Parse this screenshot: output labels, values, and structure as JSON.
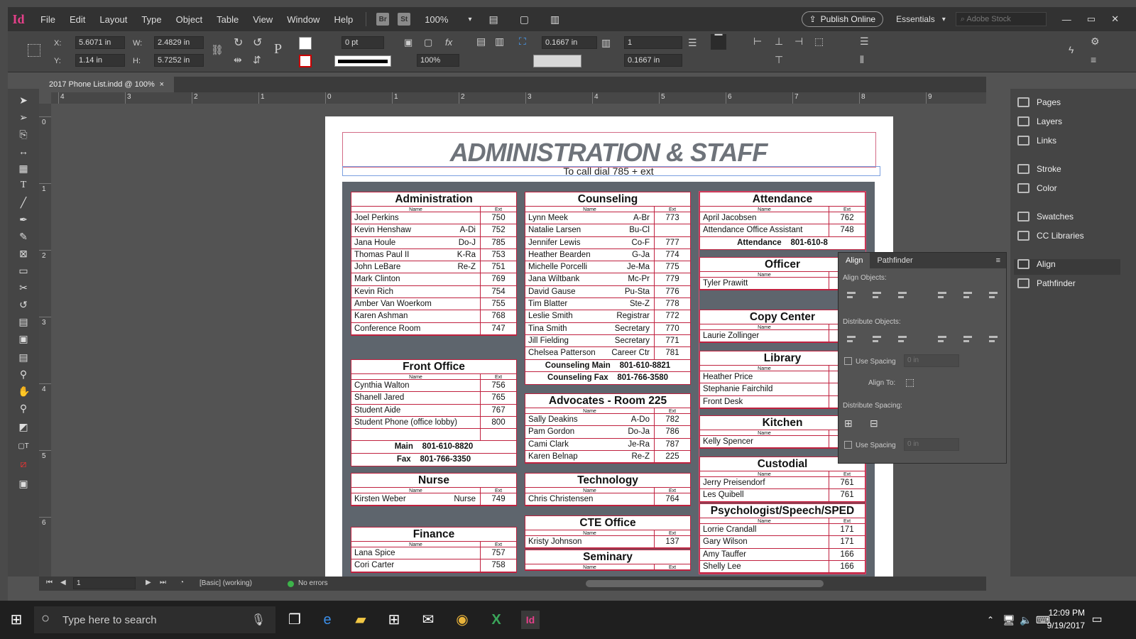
{
  "app": {
    "logo": "Id"
  },
  "menu": [
    "File",
    "Edit",
    "Layout",
    "Type",
    "Object",
    "Table",
    "View",
    "Window",
    "Help"
  ],
  "menubar": {
    "br": "Br",
    "st": "St",
    "zoom": "100%",
    "publish": "Publish Online",
    "workspace": "Essentials",
    "stock_placeholder": "Adobe Stock"
  },
  "control": {
    "x_label": "X:",
    "x": "5.6071 in",
    "y_label": "Y:",
    "y": "1.14 in",
    "w_label": "W:",
    "w": "2.4829 in",
    "h_label": "H:",
    "h": "5.7252 in",
    "stroke": "0 pt",
    "scale": "100%",
    "gap1": "0.1667 in",
    "gap2": "0.1667 in",
    "cols": "1"
  },
  "tab": {
    "label": "2017 Phone List.indd @ 100%",
    "close": "×"
  },
  "ruler_h": [
    "4",
    "3",
    "2",
    "1",
    "0",
    "1",
    "2",
    "3",
    "4",
    "5",
    "6",
    "7",
    "8",
    "9"
  ],
  "ruler_v": [
    "0",
    "1",
    "2",
    "3",
    "4",
    "5",
    "6"
  ],
  "doc": {
    "title": "ADMINISTRATION & STAFF",
    "subtitle": "To call dial 785 + ext",
    "col_name": "Name",
    "col_ext": "Ext"
  },
  "blocks": {
    "admin": {
      "title": "Administration",
      "rows": [
        [
          "Joel Perkins",
          "",
          "750"
        ],
        [
          "Kevin Henshaw",
          "A-Di",
          "752"
        ],
        [
          "Jana Houle",
          "Do-J",
          "785"
        ],
        [
          "Thomas Paul II",
          "K-Ra",
          "753"
        ],
        [
          "John LeBare",
          "Re-Z",
          "751"
        ],
        [
          "Mark Clinton",
          "",
          "769"
        ],
        [
          "Kevin Rich",
          "",
          "754"
        ],
        [
          "Amber Van Woerkom",
          "",
          "755"
        ],
        [
          "Karen Ashman",
          "",
          "768"
        ],
        [
          "Conference Room",
          "",
          "747"
        ]
      ]
    },
    "front": {
      "title": "Front Office",
      "rows": [
        [
          "Cynthia Walton",
          "",
          "756"
        ],
        [
          "Shanell Jared",
          "",
          "765"
        ],
        [
          "Student Aide",
          "",
          "767"
        ],
        [
          "Student Phone (office lobby)",
          "",
          "800"
        ],
        [
          "",
          "",
          ""
        ]
      ],
      "foot": [
        "Main    801-610-8820",
        "Fax    801-766-3350"
      ]
    },
    "nurse": {
      "title": "Nurse",
      "rows": [
        [
          "Kirsten Weber",
          "Nurse",
          "749"
        ]
      ]
    },
    "finance": {
      "title": "Finance",
      "rows": [
        [
          "Lana Spice",
          "",
          "757"
        ],
        [
          "Cori Carter",
          "",
          "758"
        ]
      ]
    },
    "counseling": {
      "title": "Counseling",
      "rows": [
        [
          "Lynn Meek",
          "A-Br",
          "773"
        ],
        [
          "Natalie Larsen",
          "Bu-Cl",
          ""
        ],
        [
          "Jennifer Lewis",
          "Co-F",
          "777"
        ],
        [
          "Heather Bearden",
          "G-Ja",
          "774"
        ],
        [
          "Michelle Porcelli",
          "Je-Ma",
          "775"
        ],
        [
          "Jana Wiltbank",
          "Mc-Pr",
          "779"
        ],
        [
          "David Gause",
          "Pu-Sta",
          "776"
        ],
        [
          "Tim Blatter",
          "Ste-Z",
          "778"
        ],
        [
          "Leslie Smith",
          "Registrar",
          "772"
        ],
        [
          "Tina Smith",
          "Secretary",
          "770"
        ],
        [
          "Jill Fielding",
          "Secretary",
          "771"
        ],
        [
          "Chelsea Patterson",
          "Career Ctr",
          "781"
        ]
      ],
      "foot": [
        "Counseling Main    801-610-8821",
        "Counseling Fax    801-766-3580"
      ]
    },
    "advocates": {
      "title": "Advocates - Room 225",
      "rows": [
        [
          "Sally Deakins",
          "A-Do",
          "782"
        ],
        [
          "Pam Gordon",
          "Do-Ja",
          "786"
        ],
        [
          "Cami Clark",
          "Je-Ra",
          "787"
        ],
        [
          "Karen Belnap",
          "Re-Z",
          "225"
        ]
      ]
    },
    "technology": {
      "title": "Technology",
      "rows": [
        [
          "Chris Christensen",
          "",
          "764"
        ]
      ]
    },
    "cte": {
      "title": "CTE Office",
      "rows": [
        [
          "Kristy Johnson",
          "",
          "137"
        ]
      ]
    },
    "seminary": {
      "title": "Seminary",
      "rows": []
    },
    "attendance": {
      "title": "Attendance",
      "rows": [
        [
          "April Jacobsen",
          "",
          "762"
        ],
        [
          "Attendance Office Assistant",
          "",
          "748"
        ]
      ],
      "foot": [
        "Attendance    801-610-8"
      ]
    },
    "officer": {
      "title": "Officer",
      "rows": [
        [
          "Tyler Prawitt",
          "",
          ""
        ]
      ]
    },
    "copy": {
      "title": "Copy Center",
      "rows": [
        [
          "Laurie Zollinger",
          "",
          ""
        ]
      ]
    },
    "library": {
      "title": "Library",
      "rows": [
        [
          "Heather Price",
          "",
          ""
        ],
        [
          "Stephanie Fairchild",
          "",
          ""
        ],
        [
          "Front Desk",
          "",
          ""
        ]
      ]
    },
    "kitchen": {
      "title": "Kitchen",
      "rows": [
        [
          "Kelly Spencer",
          "",
          ""
        ]
      ]
    },
    "custodial": {
      "title": "Custodial",
      "rows": [
        [
          "Jerry Preisendorf",
          "",
          "761"
        ],
        [
          "Les Quibell",
          "",
          "761"
        ]
      ]
    },
    "psych": {
      "title": "Psychologist/Speech/SPED",
      "rows": [
        [
          "Lorrie Crandall",
          "",
          "171"
        ],
        [
          "Gary Wilson",
          "",
          "171"
        ],
        [
          "Amy Tauffer",
          "",
          "166"
        ],
        [
          "Shelly Lee",
          "",
          "166"
        ]
      ]
    }
  },
  "align_panel": {
    "tab1": "Align",
    "tab2": "Pathfinder",
    "align_objects": "Align Objects:",
    "distribute_objects": "Distribute Objects:",
    "use_spacing": "Use Spacing",
    "align_to": "Align To:",
    "distribute_spacing": "Distribute Spacing:",
    "use_spacing2": "Use Spacing",
    "spacing_val": "0 in"
  },
  "right_panel": [
    "Pages",
    "Layers",
    "Links",
    "Stroke",
    "Color",
    "Swatches",
    "CC Libraries",
    "Align",
    "Pathfinder"
  ],
  "status": {
    "page": "1",
    "style": "[Basic] (working)",
    "errors": "No errors"
  },
  "taskbar": {
    "search": "Type here to search",
    "time": "12:09 PM",
    "date": "9/19/2017"
  }
}
